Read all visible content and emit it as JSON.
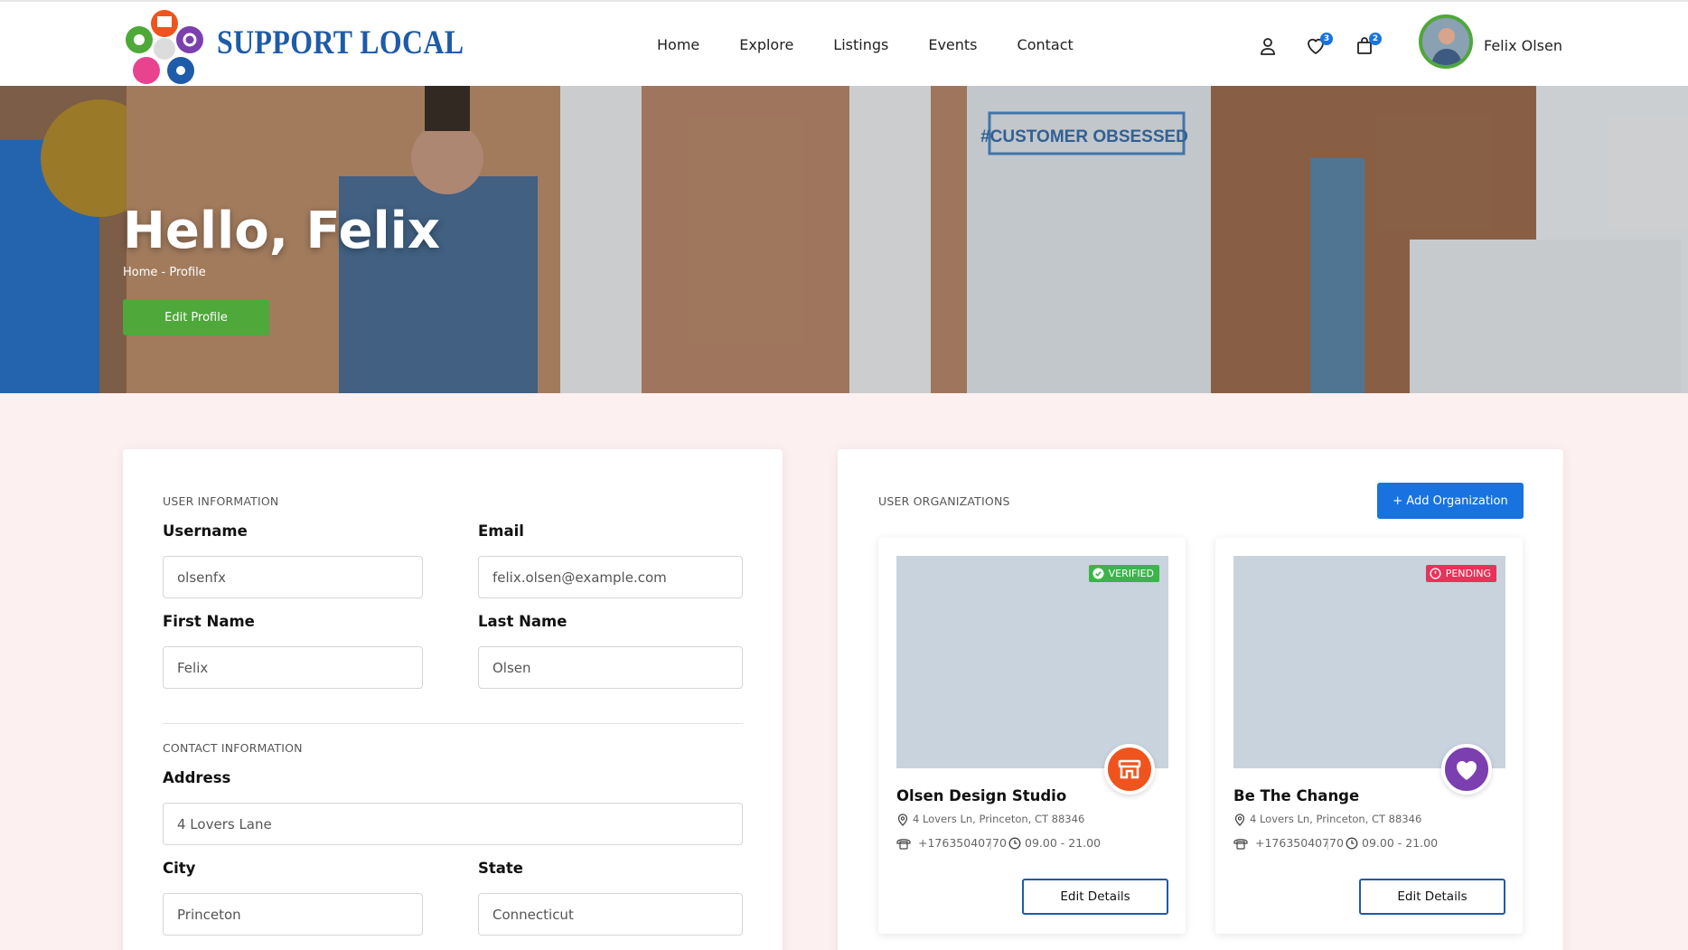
{
  "header": {
    "brand": "SUPPORT LOCAL",
    "nav": [
      "Home",
      "Explore",
      "Listings",
      "Events",
      "Contact"
    ],
    "wishlist_count": "3",
    "cart_count": "2",
    "user_name": "Felix Olsen",
    "icons": [
      "user-icon",
      "heart-icon",
      "bag-icon"
    ]
  },
  "hero": {
    "title": "Hello, Felix",
    "breadcrumb": "Home - Profile",
    "edit_button": "Edit Profile",
    "sign_tagline": "#CUSTOMER OBSESSED"
  },
  "user_info": {
    "section_title": "USER INFORMATION",
    "username_label": "Username",
    "username": "olsenfx",
    "email_label": "Email",
    "email": "felix.olsen@example.com",
    "first_name_label": "First Name",
    "first_name": "Felix",
    "last_name_label": "Last Name",
    "last_name": "Olsen"
  },
  "contact_info": {
    "section_title": "CONTACT INFORMATION",
    "address_label": "Address",
    "address": "4 Lovers Lane",
    "city_label": "City",
    "city": "Princeton",
    "state_label": "State",
    "state": "Connecticut"
  },
  "organizations": {
    "section_title": "USER ORGANIZATIONS",
    "add_button": "+  Add Organization",
    "items": [
      {
        "status": "VERIFIED",
        "status_color": "#3cb44a",
        "emblem_color": "#f0541e",
        "name": "Olsen Design Studio",
        "address": "4 Lovers Ln, Princeton, CT 88346",
        "phone": "+17635040770",
        "hours": "09.00 - 21.00",
        "button": "Edit Details"
      },
      {
        "status": "PENDING",
        "status_color": "#e8325a",
        "emblem_color": "#7b3fb0",
        "name": "Be The Change",
        "address": "4 Lovers Ln, Princeton, CT 88346",
        "phone": "+17635040770",
        "hours": "09.00 - 21.00",
        "button": "Edit Details"
      }
    ]
  },
  "colors": {
    "primary": "#1873e0",
    "brand_blue": "#1e5ba8",
    "green": "#4fa83a",
    "page_bg": "#fdf0f1"
  }
}
